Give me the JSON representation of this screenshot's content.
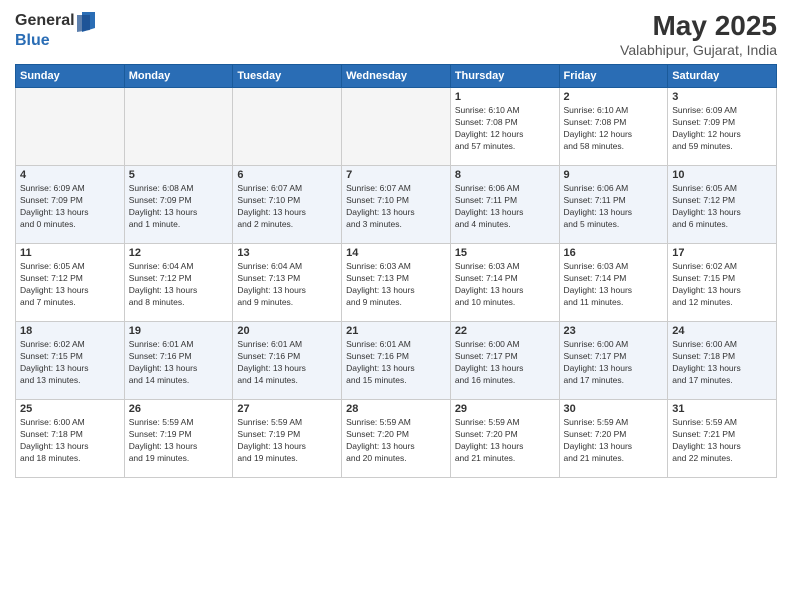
{
  "logo": {
    "general": "General",
    "blue": "Blue"
  },
  "title": {
    "month_year": "May 2025",
    "location": "Valabhipur, Gujarat, India"
  },
  "weekdays": [
    "Sunday",
    "Monday",
    "Tuesday",
    "Wednesday",
    "Thursday",
    "Friday",
    "Saturday"
  ],
  "weeks": [
    [
      {
        "day": "",
        "info": "",
        "empty": true
      },
      {
        "day": "",
        "info": "",
        "empty": true
      },
      {
        "day": "",
        "info": "",
        "empty": true
      },
      {
        "day": "",
        "info": "",
        "empty": true
      },
      {
        "day": "1",
        "info": "Sunrise: 6:10 AM\nSunset: 7:08 PM\nDaylight: 12 hours\nand 57 minutes."
      },
      {
        "day": "2",
        "info": "Sunrise: 6:10 AM\nSunset: 7:08 PM\nDaylight: 12 hours\nand 58 minutes."
      },
      {
        "day": "3",
        "info": "Sunrise: 6:09 AM\nSunset: 7:09 PM\nDaylight: 12 hours\nand 59 minutes."
      }
    ],
    [
      {
        "day": "4",
        "info": "Sunrise: 6:09 AM\nSunset: 7:09 PM\nDaylight: 13 hours\nand 0 minutes."
      },
      {
        "day": "5",
        "info": "Sunrise: 6:08 AM\nSunset: 7:09 PM\nDaylight: 13 hours\nand 1 minute."
      },
      {
        "day": "6",
        "info": "Sunrise: 6:07 AM\nSunset: 7:10 PM\nDaylight: 13 hours\nand 2 minutes."
      },
      {
        "day": "7",
        "info": "Sunrise: 6:07 AM\nSunset: 7:10 PM\nDaylight: 13 hours\nand 3 minutes."
      },
      {
        "day": "8",
        "info": "Sunrise: 6:06 AM\nSunset: 7:11 PM\nDaylight: 13 hours\nand 4 minutes."
      },
      {
        "day": "9",
        "info": "Sunrise: 6:06 AM\nSunset: 7:11 PM\nDaylight: 13 hours\nand 5 minutes."
      },
      {
        "day": "10",
        "info": "Sunrise: 6:05 AM\nSunset: 7:12 PM\nDaylight: 13 hours\nand 6 minutes."
      }
    ],
    [
      {
        "day": "11",
        "info": "Sunrise: 6:05 AM\nSunset: 7:12 PM\nDaylight: 13 hours\nand 7 minutes."
      },
      {
        "day": "12",
        "info": "Sunrise: 6:04 AM\nSunset: 7:12 PM\nDaylight: 13 hours\nand 8 minutes."
      },
      {
        "day": "13",
        "info": "Sunrise: 6:04 AM\nSunset: 7:13 PM\nDaylight: 13 hours\nand 9 minutes."
      },
      {
        "day": "14",
        "info": "Sunrise: 6:03 AM\nSunset: 7:13 PM\nDaylight: 13 hours\nand 9 minutes."
      },
      {
        "day": "15",
        "info": "Sunrise: 6:03 AM\nSunset: 7:14 PM\nDaylight: 13 hours\nand 10 minutes."
      },
      {
        "day": "16",
        "info": "Sunrise: 6:03 AM\nSunset: 7:14 PM\nDaylight: 13 hours\nand 11 minutes."
      },
      {
        "day": "17",
        "info": "Sunrise: 6:02 AM\nSunset: 7:15 PM\nDaylight: 13 hours\nand 12 minutes."
      }
    ],
    [
      {
        "day": "18",
        "info": "Sunrise: 6:02 AM\nSunset: 7:15 PM\nDaylight: 13 hours\nand 13 minutes."
      },
      {
        "day": "19",
        "info": "Sunrise: 6:01 AM\nSunset: 7:16 PM\nDaylight: 13 hours\nand 14 minutes."
      },
      {
        "day": "20",
        "info": "Sunrise: 6:01 AM\nSunset: 7:16 PM\nDaylight: 13 hours\nand 14 minutes."
      },
      {
        "day": "21",
        "info": "Sunrise: 6:01 AM\nSunset: 7:16 PM\nDaylight: 13 hours\nand 15 minutes."
      },
      {
        "day": "22",
        "info": "Sunrise: 6:00 AM\nSunset: 7:17 PM\nDaylight: 13 hours\nand 16 minutes."
      },
      {
        "day": "23",
        "info": "Sunrise: 6:00 AM\nSunset: 7:17 PM\nDaylight: 13 hours\nand 17 minutes."
      },
      {
        "day": "24",
        "info": "Sunrise: 6:00 AM\nSunset: 7:18 PM\nDaylight: 13 hours\nand 17 minutes."
      }
    ],
    [
      {
        "day": "25",
        "info": "Sunrise: 6:00 AM\nSunset: 7:18 PM\nDaylight: 13 hours\nand 18 minutes."
      },
      {
        "day": "26",
        "info": "Sunrise: 5:59 AM\nSunset: 7:19 PM\nDaylight: 13 hours\nand 19 minutes."
      },
      {
        "day": "27",
        "info": "Sunrise: 5:59 AM\nSunset: 7:19 PM\nDaylight: 13 hours\nand 19 minutes."
      },
      {
        "day": "28",
        "info": "Sunrise: 5:59 AM\nSunset: 7:20 PM\nDaylight: 13 hours\nand 20 minutes."
      },
      {
        "day": "29",
        "info": "Sunrise: 5:59 AM\nSunset: 7:20 PM\nDaylight: 13 hours\nand 21 minutes."
      },
      {
        "day": "30",
        "info": "Sunrise: 5:59 AM\nSunset: 7:20 PM\nDaylight: 13 hours\nand 21 minutes."
      },
      {
        "day": "31",
        "info": "Sunrise: 5:59 AM\nSunset: 7:21 PM\nDaylight: 13 hours\nand 22 minutes."
      }
    ]
  ]
}
